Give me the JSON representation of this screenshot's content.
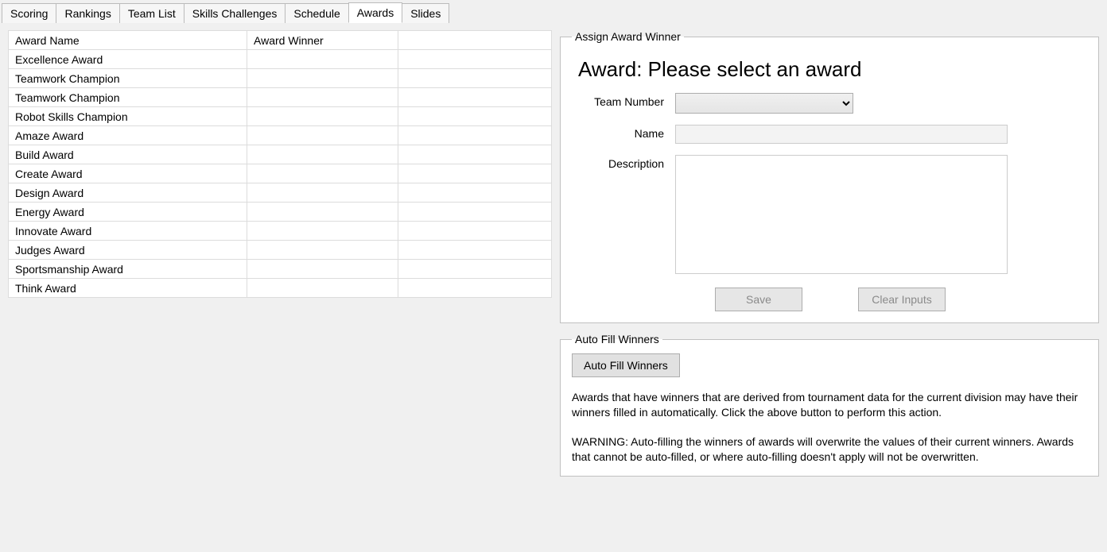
{
  "tabs": [
    {
      "label": "Scoring"
    },
    {
      "label": "Rankings"
    },
    {
      "label": "Team List"
    },
    {
      "label": "Skills Challenges"
    },
    {
      "label": "Schedule"
    },
    {
      "label": "Awards",
      "active": true
    },
    {
      "label": "Slides"
    }
  ],
  "awards_table": {
    "header_name": "Award Name",
    "header_winner": "Award Winner",
    "rows": [
      {
        "name": "Excellence Award",
        "winner": ""
      },
      {
        "name": "Teamwork Champion",
        "winner": ""
      },
      {
        "name": "Teamwork Champion",
        "winner": ""
      },
      {
        "name": "Robot Skills Champion",
        "winner": ""
      },
      {
        "name": "Amaze Award",
        "winner": ""
      },
      {
        "name": "Build Award",
        "winner": ""
      },
      {
        "name": "Create Award",
        "winner": ""
      },
      {
        "name": "Design Award",
        "winner": ""
      },
      {
        "name": "Energy Award",
        "winner": ""
      },
      {
        "name": "Innovate Award",
        "winner": ""
      },
      {
        "name": "Judges Award",
        "winner": ""
      },
      {
        "name": "Sportsmanship Award",
        "winner": ""
      },
      {
        "name": "Think Award",
        "winner": ""
      }
    ]
  },
  "assign_panel": {
    "legend": "Assign Award Winner",
    "heading": "Award: Please select an award",
    "team_label": "Team Number",
    "team_value": "",
    "name_label": "Name",
    "name_value": "",
    "desc_label": "Description",
    "desc_value": "",
    "save_label": "Save",
    "clear_label": "Clear Inputs"
  },
  "autofill_panel": {
    "legend": "Auto Fill Winners",
    "button_label": "Auto Fill Winners",
    "paragraph": "Awards that have winners that are derived from tournament data for the current division may have their winners filled in automatically. Click the above button to perform this action.",
    "warning": "WARNING: Auto-filling the winners of awards will overwrite the values of their current winners. Awards that cannot be auto-filled, or where auto-filling doesn't apply will not be overwritten."
  }
}
